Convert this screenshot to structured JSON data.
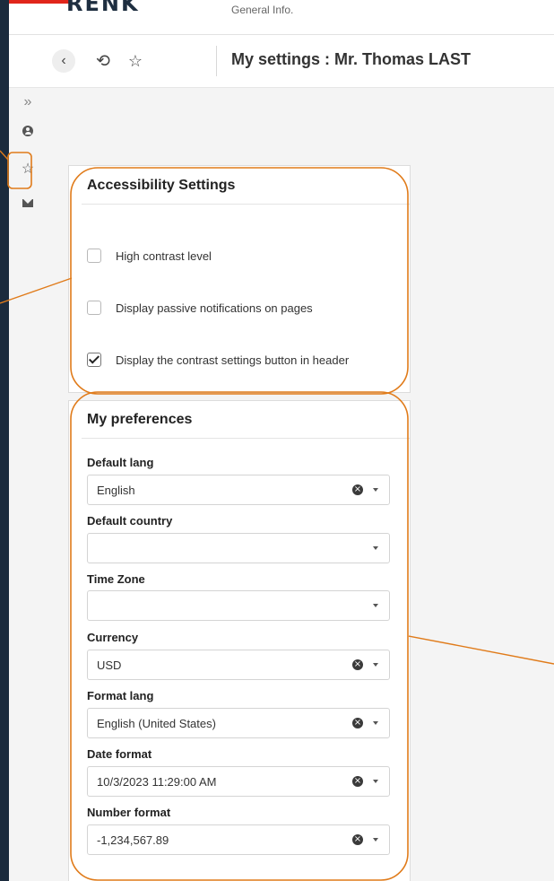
{
  "header": {
    "brand": "RENK",
    "app_menu": "General Info."
  },
  "navbar": {
    "back_icon": "chevron-left-icon",
    "history_icon": "history-icon",
    "favorite_icon": "star-icon",
    "page_title": "My settings : Mr. Thomas LAST"
  },
  "side_rail": {
    "expand": "»",
    "items": [
      "user-icon",
      "star-icon",
      "mail-icon"
    ]
  },
  "accessibility": {
    "title": "Accessibility Settings",
    "options": [
      {
        "label": "High contrast level",
        "checked": false
      },
      {
        "label": "Display passive notifications on pages",
        "checked": false
      },
      {
        "label": "Display the contrast settings button in header",
        "checked": true
      }
    ]
  },
  "preferences": {
    "title": "My preferences",
    "fields": [
      {
        "label": "Default lang",
        "value": "English",
        "clearable": true
      },
      {
        "label": "Default country",
        "value": "",
        "clearable": false
      },
      {
        "label": "Time Zone",
        "value": "",
        "clearable": false
      },
      {
        "label": "Currency",
        "value": "USD",
        "clearable": true
      },
      {
        "label": "Format lang",
        "value": "English (United States)",
        "clearable": true
      },
      {
        "label": "Date format",
        "value": "10/3/2023 11:29:00 AM",
        "clearable": true
      },
      {
        "label": "Number format",
        "value": "-1,234,567.89",
        "clearable": true
      }
    ]
  },
  "colors": {
    "brand_accent": "#e1251b",
    "annotation": "#e07b1a",
    "frame": "#1b2b3d"
  }
}
